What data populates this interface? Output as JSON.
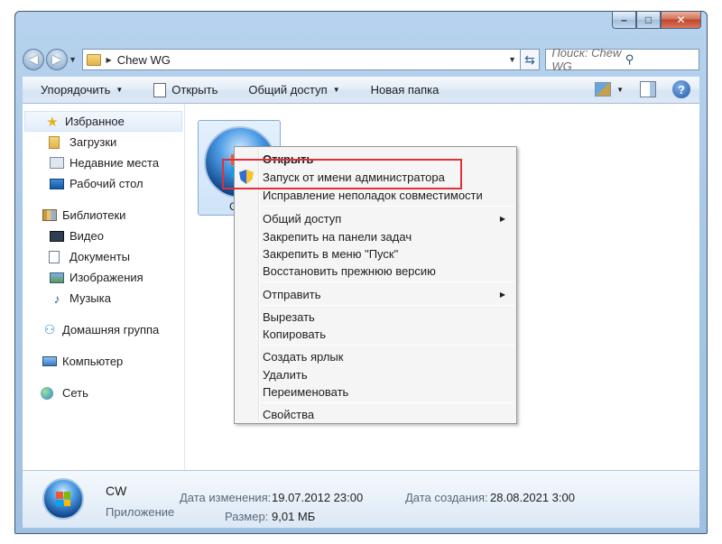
{
  "window": {
    "caption_buttons": {
      "minimize": "–",
      "maximize": "□",
      "close": "✕"
    },
    "address": {
      "path": "Chew WG",
      "search_placeholder": "Поиск: Chew WG"
    },
    "toolbar": {
      "organize": "Упорядочить",
      "open": "Открыть",
      "share": "Общий доступ",
      "new_folder": "Новая папка",
      "help": "?"
    },
    "nav": {
      "favorites": "Избранное",
      "downloads": "Загрузки",
      "recent": "Недавние места",
      "desktop": "Рабочий стол",
      "libraries": "Библиотеки",
      "video": "Видео",
      "documents": "Документы",
      "images": "Изображения",
      "music": "Музыка",
      "homegroup": "Домашняя группа",
      "computer": "Компьютер",
      "network": "Сеть"
    },
    "file": {
      "label": "CW"
    },
    "details": {
      "name": "CW",
      "type": "Приложение",
      "modified_label": "Дата изменения:",
      "modified_value": "19.07.2012 23:00",
      "size_label": "Размер:",
      "size_value": "9,01 МБ",
      "created_label": "Дата создания:",
      "created_value": "28.08.2021 3:00"
    }
  },
  "context_menu": {
    "open": "Открыть",
    "run_as_admin": "Запуск от имени администратора",
    "troubleshoot": "Исправление неполадок совместимости",
    "share": "Общий доступ",
    "pin_taskbar": "Закрепить на панели задач",
    "pin_start": "Закрепить в меню \"Пуск\"",
    "restore": "Восстановить прежнюю версию",
    "send_to": "Отправить",
    "cut": "Вырезать",
    "copy": "Копировать",
    "create_shortcut": "Создать ярлык",
    "delete": "Удалить",
    "rename": "Переименовать",
    "properties": "Свойства"
  },
  "colors": {
    "highlight_border": "#e0303a",
    "window_frame": "#a9c8e6",
    "selection": "#cfe3f8"
  },
  "icons": [
    "back-icon",
    "forward-icon",
    "folder-icon",
    "refresh-icon",
    "search-icon",
    "help-icon",
    "shield-icon",
    "windows-flag-icon"
  ]
}
